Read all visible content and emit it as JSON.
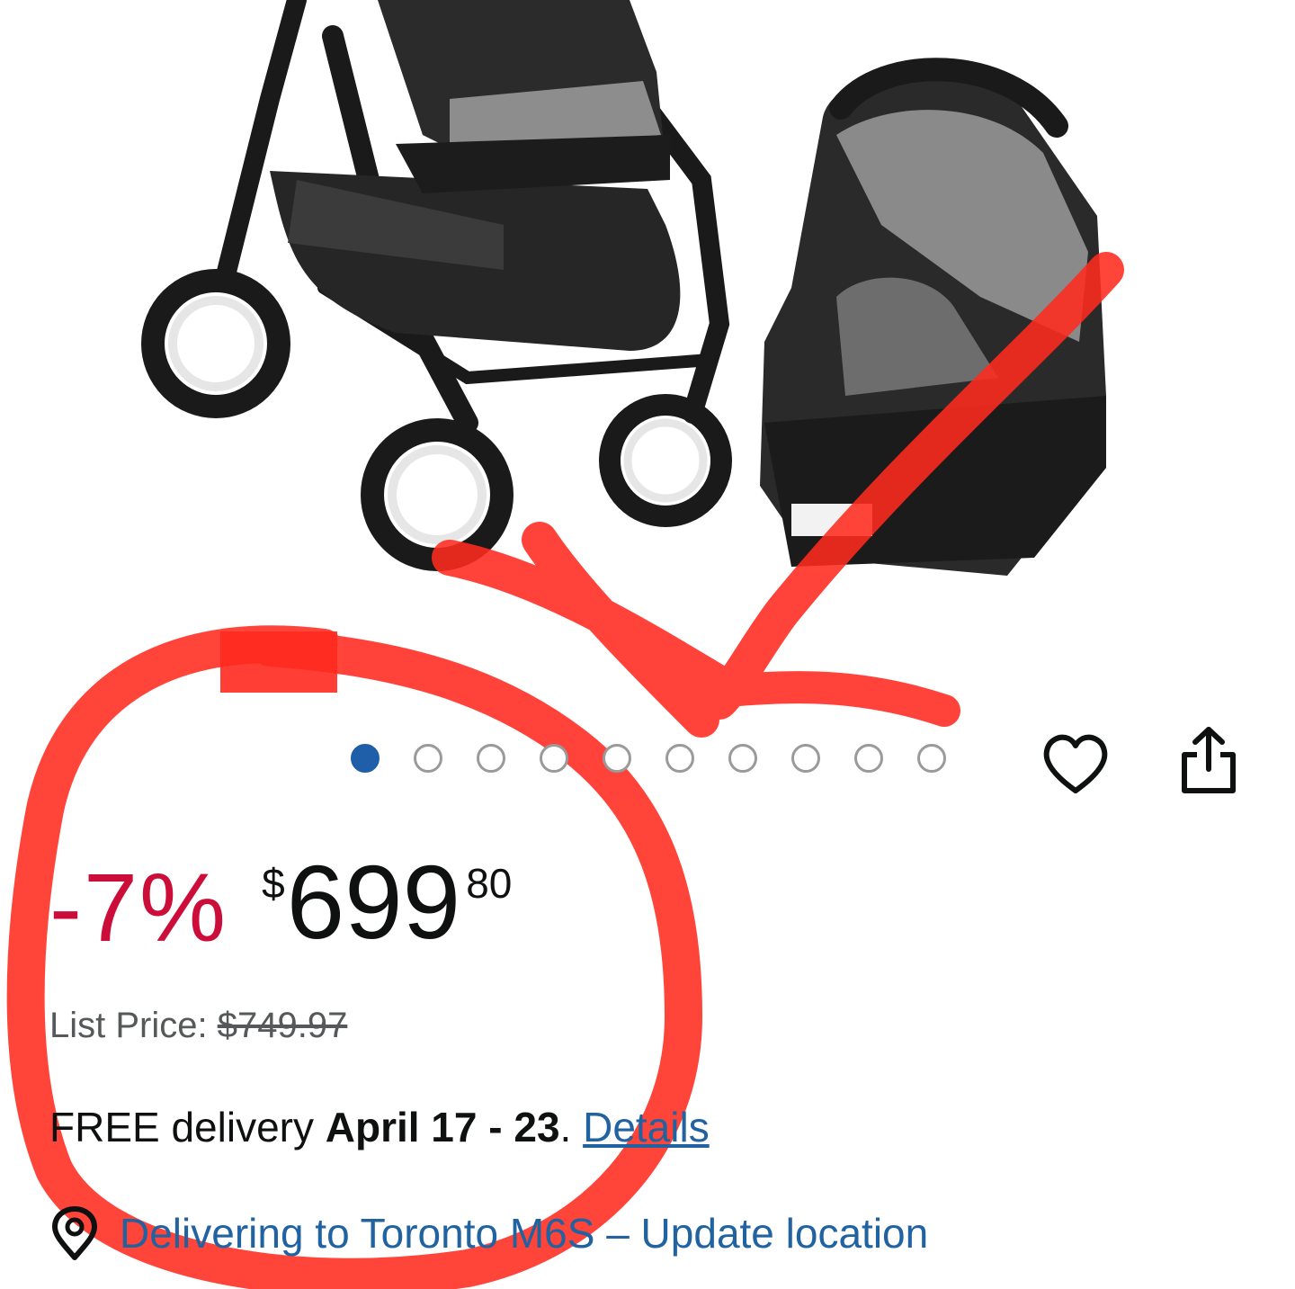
{
  "carousel": {
    "total": 10,
    "active_index": 0
  },
  "price": {
    "discount": "-7%",
    "currency": "$",
    "whole": "699",
    "fraction": "80"
  },
  "list_price": {
    "label": "List Price: ",
    "value": "$749.97"
  },
  "delivery": {
    "prefix": "FREE delivery ",
    "dates": "April 17 - 23",
    "separator": ". ",
    "details_link": "Details"
  },
  "location": {
    "text": "Delivering to Toronto M6S – Update location"
  },
  "colors": {
    "discount": "#cc0c39",
    "link": "#2162a1",
    "active_dot": "#1f5ea8",
    "annotation": "#ff2a1f"
  }
}
